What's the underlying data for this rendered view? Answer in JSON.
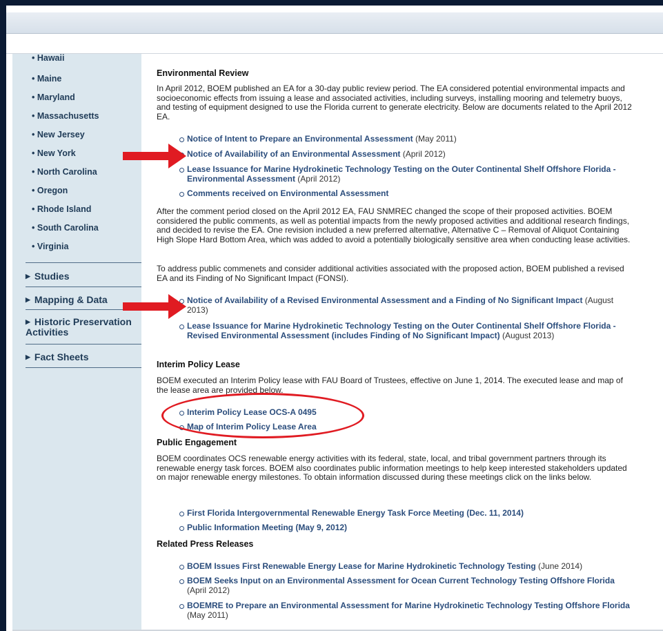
{
  "sidebar": {
    "states": [
      "Hawaii",
      "Maine",
      "Maryland",
      "Massachusetts",
      "New Jersey",
      "New York",
      "North Carolina",
      "Oregon",
      "Rhode Island",
      "South Carolina",
      "Virginia"
    ],
    "nav": [
      "Studies",
      "Mapping & Data",
      "Historic Preservation Activities",
      "Fact Sheets"
    ]
  },
  "content": {
    "env_review_heading": "Environmental Review",
    "env_review_para": "In April 2012, BOEM published an EA for a 30-day public review period. The EA considered potential environmental impacts and socioeconomic effects from issuing a lease and associated activities, including surveys, installing mooring and telemetry buoys, and testing of equipment designed to use the Florida current to generate electricity. Below are documents related to the April 2012 EA.",
    "links_a": [
      {
        "bold": "Notice of Intent to Prepare an Environmental Assessment",
        "normal": " (May 2011)"
      },
      {
        "bold": "Notice of Availability of an Environmental Assessment",
        "normal": " (April 2012)"
      },
      {
        "bold": "Lease Issuance for Marine Hydrokinetic Technology Testing on the Outer Continental Shelf Offshore Florida - Environmental Assessment",
        "normal": " (April 2012)"
      },
      {
        "bold": "Comments received on Environmental Assessment",
        "normal": ""
      }
    ],
    "after_para": "After the comment period closed on the April 2012 EA, FAU SNMREC changed the scope of their proposed activities. BOEM considered the public comments, as well as potential impacts from the newly proposed activities and additional research findings, and decided to revise the EA. One revision included a new preferred alternative, Alternative C – Removal of Aliquot Containing High Slope Hard Bottom Area, which was added to avoid a potentially biologically sensitive area when conducting lease activities.",
    "address_para": "To address public commenets and consider additional activities associated with the proposed action, BOEM published a revised EA and its Finding of No Significant Impact (FONSI).",
    "links_b": [
      {
        "bold": "Notice of Availability of a Revised Environmental Assessment and a Finding of No Significant Impact",
        "normal": " (August 2013)"
      },
      {
        "bold": "Lease Issuance for Marine Hydrokinetic Technology Testing on the Outer Continental Shelf Offshore Florida - Revised Environmental Assessment (includes Finding of No Significant Impact)",
        "normal": " (August 2013)"
      }
    ],
    "ipl_heading": "Interim Policy Lease",
    "ipl_para": "BOEM executed an Interim Policy lease with FAU Board of Trustees, effective on June 1, 2014. The executed lease and map of the lease area are provided below.",
    "links_c": [
      {
        "bold": "Interim Policy Lease OCS-A 0495",
        "normal": ""
      },
      {
        "bold": "Map of Interim Policy Lease Area",
        "normal": ""
      }
    ],
    "pe_heading": "Public Engagement",
    "pe_para": "BOEM coordinates OCS renewable energy activities with its federal, state, local, and tribal government partners through its renewable energy task forces. BOEM also coordinates public information meetings to help keep interested stakeholders updated on major renewable energy milestones. To obtain information discussed during these meetings click on the links below.",
    "links_d": [
      {
        "bold": "First Florida Intergovernmental Renewable Energy Task Force Meeting (Dec. 11, 2014)",
        "normal": ""
      },
      {
        "bold": "Public Information Meeting (May 9, 2012)",
        "normal": ""
      }
    ],
    "rpr_heading": "Related Press Releases",
    "links_e": [
      {
        "bold": "BOEM Issues First Renewable Energy Lease for Marine Hydrokinetic Technology Testing",
        "normal": " (June 2014)"
      },
      {
        "bold": "BOEM Seeks Input on an Environmental Assessment for Ocean Current Technology Testing Offshore Florida",
        "normal": " (April 2012)"
      },
      {
        "bold": "BOEMRE to Prepare an Environmental Assessment for Marine Hydrokinetic Technology Testing Offshore Florida",
        "normal": " (May 2011)"
      }
    ]
  },
  "colors": {
    "accent": "#2b4d7c",
    "annotation": "#e01b22",
    "sidebar_bg": "#dbe7ee"
  }
}
